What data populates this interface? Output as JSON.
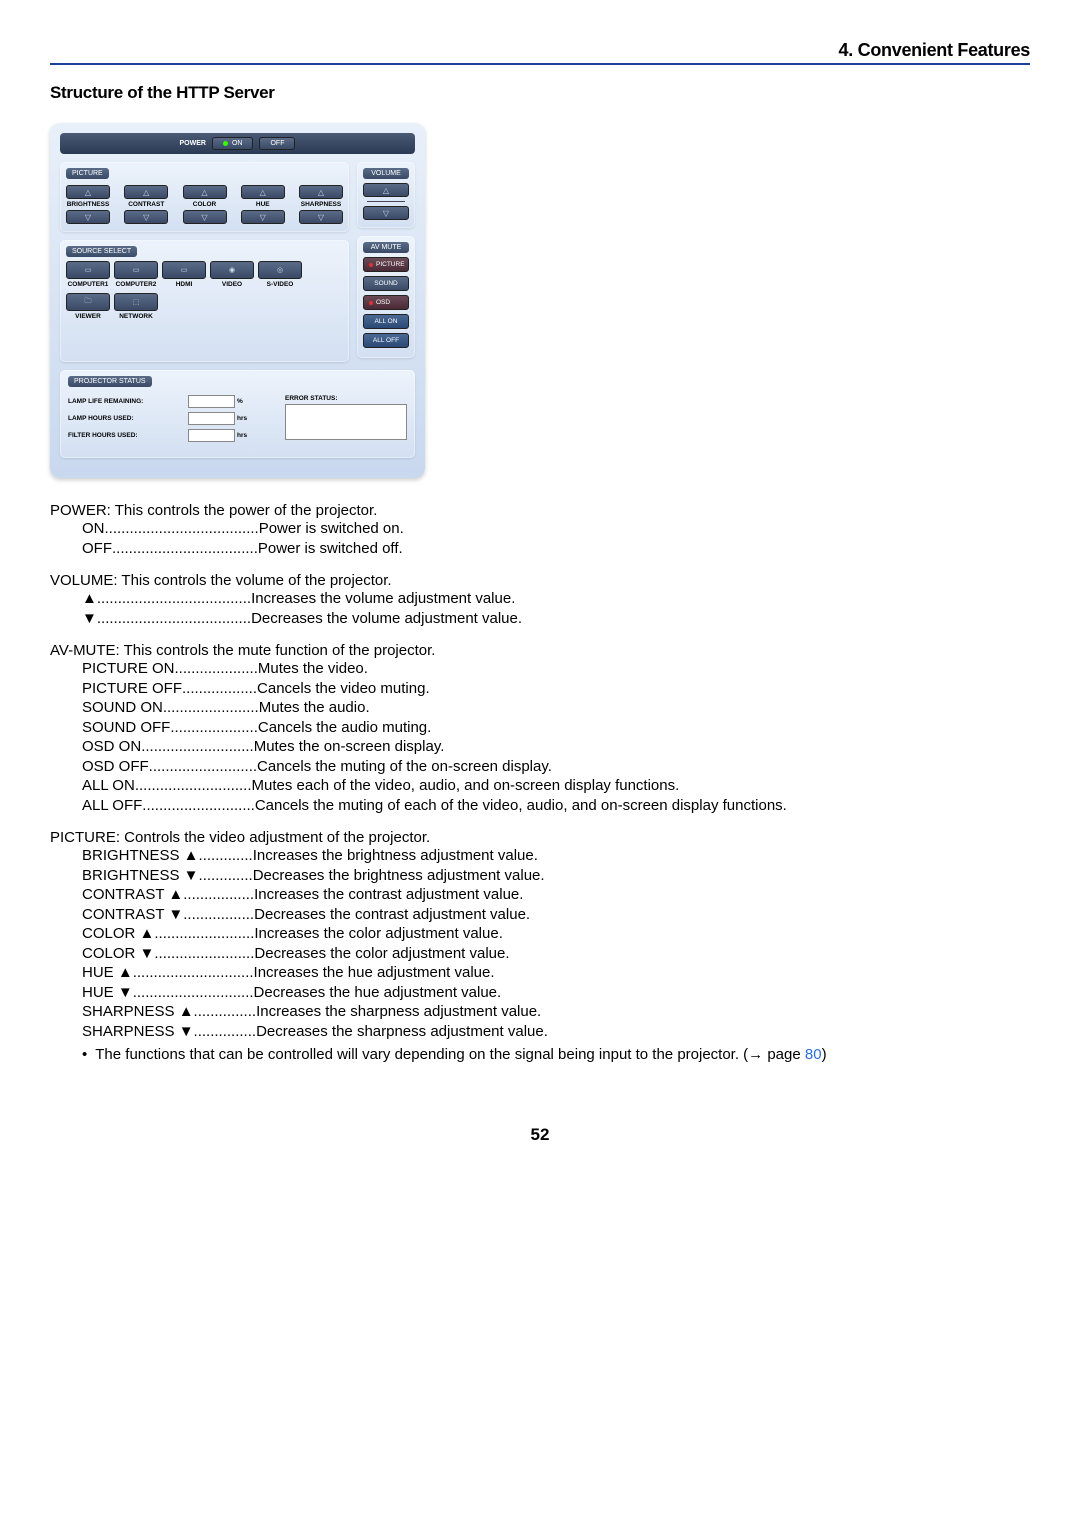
{
  "chapter": "4. Convenient Features",
  "section_title": "Structure of the HTTP Server",
  "page_number": "52",
  "ui": {
    "power_label": "POWER",
    "on": "ON",
    "off": "OFF",
    "picture": "PICTURE",
    "volume": "VOLUME",
    "source_select": "SOURCE SELECT",
    "av_mute": "AV MUTE",
    "projector_status": "PROJECTOR STATUS",
    "pic_cols": [
      "BRIGHTNESS",
      "CONTRAST",
      "COLOR",
      "HUE",
      "SHARPNESS"
    ],
    "sources": [
      "COMPUTER1",
      "COMPUTER2",
      "HDMI",
      "VIDEO",
      "S-VIDEO",
      "VIEWER",
      "NETWORK"
    ],
    "mute_btns": {
      "picture": "PICTURE",
      "sound": "SOUND",
      "osd": "OSD",
      "all_on": "ALL ON",
      "all_off": "ALL OFF"
    },
    "status": {
      "lamp_life": "LAMP LIFE REMAINING:",
      "lamp_hours": "LAMP HOURS USED:",
      "filter_hours": "FILTER HOURS USED:",
      "error": "ERROR STATUS:",
      "pct": "%",
      "hrs": "hrs"
    }
  },
  "power": {
    "head": "POWER: This controls the power of the projector.",
    "rows": [
      {
        "term": "ON",
        "dots": ".....................................",
        "desc": "Power is switched on."
      },
      {
        "term": "OFF",
        "dots": "...................................",
        "desc": "Power is switched off."
      }
    ]
  },
  "volume": {
    "head": "VOLUME: This controls the volume of the projector.",
    "rows": [
      {
        "term": "▲",
        "dots": " .....................................",
        "desc": "Increases the volume adjustment value."
      },
      {
        "term": "▼",
        "dots": " .....................................",
        "desc": "Decreases the volume adjustment value."
      }
    ]
  },
  "avmute": {
    "head": "AV-MUTE: This controls the mute function of the projector.",
    "rows": [
      {
        "term": "PICTURE ON",
        "dots": " ....................",
        "desc": "Mutes the video."
      },
      {
        "term": "PICTURE OFF",
        "dots": " ..................",
        "desc": "Cancels the video muting."
      },
      {
        "term": "SOUND ON",
        "dots": ".......................",
        "desc": "Mutes the audio."
      },
      {
        "term": "SOUND OFF",
        "dots": " .....................",
        "desc": "Cancels the audio muting."
      },
      {
        "term": "OSD ON",
        "dots": " ...........................",
        "desc": "Mutes the on-screen display."
      },
      {
        "term": "OSD OFF",
        "dots": " ..........................",
        "desc": "Cancels the muting of the on-screen display."
      },
      {
        "term": "ALL ON",
        "dots": " ............................",
        "desc": "Mutes each of the video, audio, and on-screen display functions."
      },
      {
        "term": "ALL OFF",
        "dots": "...........................",
        "desc": "Cancels the muting of each of the video, audio, and on-screen display functions."
      }
    ]
  },
  "picture": {
    "head": "PICTURE: Controls the video adjustment of the projector.",
    "rows": [
      {
        "term": "BRIGHTNESS ▲",
        "dots": "  .............",
        "desc": "Increases the brightness adjustment value."
      },
      {
        "term": "BRIGHTNESS ▼",
        "dots": "  .............",
        "desc": "Decreases the brightness adjustment value."
      },
      {
        "term": "CONTRAST ▲",
        "dots": "  .................",
        "desc": "Increases the contrast adjustment value."
      },
      {
        "term": "CONTRAST ▼",
        "dots": "  .................",
        "desc": "Decreases the contrast adjustment value."
      },
      {
        "term": "COLOR ▲",
        "dots": "  ........................",
        "desc": "Increases the color adjustment value."
      },
      {
        "term": "COLOR ▼",
        "dots": "  ........................",
        "desc": "Decreases the color adjustment value."
      },
      {
        "term": "HUE ▲",
        "dots": "  .............................",
        "desc": "Increases the hue adjustment value."
      },
      {
        "term": "HUE ▼",
        "dots": "  .............................",
        "desc": "Decreases the hue adjustment value."
      },
      {
        "term": "SHARPNESS ▲",
        "dots": "  ...............",
        "desc": "Increases the sharpness adjustment value."
      },
      {
        "term": "SHARPNESS ▼",
        "dots": "  ...............",
        "desc": "Decreases the sharpness adjustment value."
      }
    ],
    "note_prefix": "The functions that can be controlled will vary depending on the signal being input to the projector. (→ page ",
    "note_link": "80",
    "note_suffix": ")"
  }
}
